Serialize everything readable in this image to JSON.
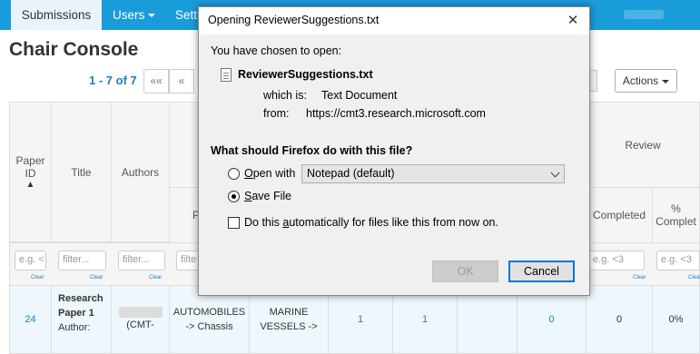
{
  "nav": {
    "active": "Submissions",
    "users": "Users",
    "settings": "Setti"
  },
  "page": {
    "title": "Chair Console",
    "pager_text": "1 - 7 of 7",
    "first_label": "«««",
    "prev_label": "«",
    "actions_label": "Actions"
  },
  "table": {
    "headers": {
      "paper_id": "Paper ID",
      "sort_arrow": "🠕",
      "title": "Title",
      "authors": "Authors",
      "primary_partial": "P",
      "review": "Review",
      "completed": "Completed",
      "pct_completed": "% Complet"
    },
    "filters": {
      "paper_id": "e.g. <",
      "title": "filter...",
      "authors": "filter...",
      "primary": "filte",
      "completed": "e.g. <3",
      "pct": "e.g. <3",
      "clear": "Clear"
    },
    "row": {
      "paper_id": "24",
      "title_line1": "Research",
      "title_line2": "Paper 1",
      "title_line3": "Author:",
      "author_partial": "(CMT-",
      "primary_line1": "AUTOMOBILES",
      "primary_line2": "-> Chassis",
      "secondary_line1": "MARINE",
      "secondary_line2": "VESSELS ->",
      "v1": "1",
      "v2": "1",
      "v3": "0",
      "v4": "0",
      "v5": "0%"
    }
  },
  "dialog": {
    "title": "Opening ReviewerSuggestions.txt",
    "close": "✕",
    "intro": "You have chosen to open:",
    "filename": "ReviewerSuggestions.txt",
    "which_is_label": "which is:",
    "which_is_value": "Text Document",
    "from_label": "from:",
    "from_value": "https://cmt3.research.microsoft.com",
    "question": "What should Firefox do with this file?",
    "open_with_label": "Open with",
    "open_with_app": "Notepad (default)",
    "save_file_label": "Save File",
    "auto_label": "Do this automatically for files like this from now on.",
    "ok": "OK",
    "cancel": "Cancel",
    "selected_option": "save_file"
  }
}
